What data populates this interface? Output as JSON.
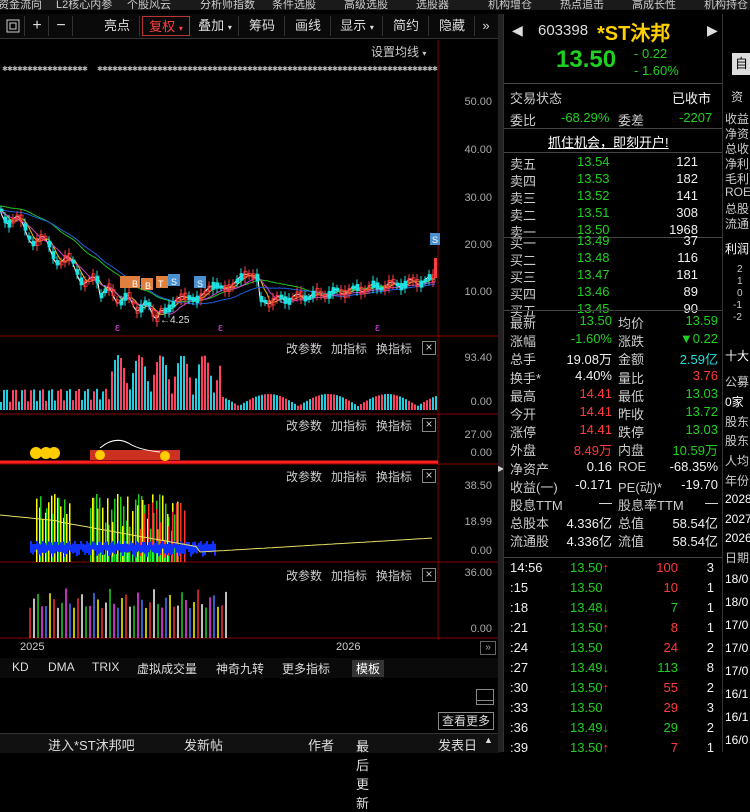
{
  "menu": [
    "资金流向",
    "L2核心内参",
    "个股风云",
    "分析师指数",
    "条件选股",
    "高级选股",
    "选股器",
    "机构增仓",
    "热点追击",
    "高成长性",
    "机构持仓"
  ],
  "toolbar": {
    "btn1": "亮点",
    "btn2": "复权",
    "btn3": "叠加",
    "btn4": "筹码",
    "btn5": "画线",
    "btn6": "显示",
    "btn7": "简约",
    "btn8": "隐藏"
  },
  "chart": {
    "setting_label": "设置均线",
    "price_axis": [
      "50.00",
      "40.00",
      "30.00",
      "20.00",
      "10.00"
    ],
    "low_label": "4.25",
    "markers": [
      "BS",
      "BS",
      "B",
      "T",
      "S",
      "S"
    ],
    "dates": [
      "2025",
      "2026"
    ]
  },
  "panel_controls": {
    "params": "改参数",
    "add": "加指标",
    "switch": "换指标",
    "close": "×"
  },
  "panels": [
    {
      "axis_top": "93.40",
      "axis_bottom": "0.00"
    },
    {
      "axis_top": "27.00",
      "axis_bottom": "0.00"
    },
    {
      "axis_top": "38.50",
      "axis_mid": "18.99",
      "axis_bottom": "0.00"
    },
    {
      "axis_top": "36.00",
      "axis_bottom": "0.00"
    }
  ],
  "bottom_tabs": [
    "KD",
    "DMA",
    "TRIX",
    "虚拟成交量",
    "神奇九转",
    "更多指标",
    "模板"
  ],
  "bottom_bar": {
    "enter": "进入*ST沐邦吧",
    "post": "发新帖",
    "author": "作者",
    "latest": "最后更新",
    "send": "发表日",
    "more": "查看更多"
  },
  "quote": {
    "code": "603398",
    "name": "*ST沐邦",
    "price": "13.50",
    "change": "- 0.22",
    "change_pct": "- 1.60%",
    "auto_btn": "自",
    "status_label": "交易状态",
    "status_value": "已收市",
    "weibi_label": "委比",
    "weibi_value": "-68.29%",
    "weicha_label": "委差",
    "weicha_value": "-2207",
    "promo": "抓住机会，即刻开户!",
    "asks": [
      {
        "label": "卖五",
        "price": "13.54",
        "vol": "121"
      },
      {
        "label": "卖四",
        "price": "13.53",
        "vol": "182"
      },
      {
        "label": "卖三",
        "price": "13.52",
        "vol": "141"
      },
      {
        "label": "卖二",
        "price": "13.51",
        "vol": "308"
      },
      {
        "label": "卖一",
        "price": "13.50",
        "vol": "1968"
      }
    ],
    "bids": [
      {
        "label": "买一",
        "price": "13.49",
        "vol": "37"
      },
      {
        "label": "买二",
        "price": "13.48",
        "vol": "116"
      },
      {
        "label": "买三",
        "price": "13.47",
        "vol": "181"
      },
      {
        "label": "买四",
        "price": "13.46",
        "vol": "89"
      },
      {
        "label": "买五",
        "price": "13.45",
        "vol": "90"
      }
    ],
    "stats": [
      {
        "l1": "最新",
        "v1": "13.50",
        "l2": "均价",
        "v2": "13.59"
      },
      {
        "l1": "涨幅",
        "v1": "-1.60%",
        "l2": "涨跌",
        "v2": "▼0.22"
      },
      {
        "l1": "总手",
        "v1": "19.08万",
        "l2": "金额",
        "v2": "2.59亿"
      },
      {
        "l1": "换手*",
        "v1": "4.40%",
        "l2": "量比",
        "v2": "3.76"
      },
      {
        "l1": "最高",
        "v1": "14.41",
        "l2": "最低",
        "v2": "13.03"
      },
      {
        "l1": "今开",
        "v1": "14.41",
        "l2": "昨收",
        "v2": "13.72"
      },
      {
        "l1": "涨停",
        "v1": "14.41",
        "l2": "跌停",
        "v2": "13.03"
      },
      {
        "l1": "外盘",
        "v1": "8.49万",
        "l2": "内盘",
        "v2": "10.59万"
      },
      {
        "l1": "净资产",
        "v1": "0.16",
        "l2": "ROE",
        "v2": "-68.35%"
      },
      {
        "l1": "收益(一)",
        "v1": "-0.171",
        "l2": "PE(动)*",
        "v2": "-19.70"
      },
      {
        "l1": "股息TTM",
        "v1": "—",
        "l2": "股息率TTM",
        "v2": "—"
      },
      {
        "l1": "总股本",
        "v1": "4.336亿",
        "l2": "总值",
        "v2": "58.54亿"
      },
      {
        "l1": "流通股",
        "v1": "4.336亿",
        "l2": "流值",
        "v2": "58.54亿"
      }
    ],
    "ticks": [
      {
        "t": "14:56",
        "p": "13.50",
        "a": "↑",
        "v": "100",
        "n": "3"
      },
      {
        "t": ":15",
        "p": "13.50",
        "a": "",
        "v": "10",
        "n": "1"
      },
      {
        "t": ":18",
        "p": "13.48",
        "a": "↓",
        "v": "7",
        "n": "1"
      },
      {
        "t": ":21",
        "p": "13.50",
        "a": "↑",
        "v": "8",
        "n": "1"
      },
      {
        "t": ":24",
        "p": "13.50",
        "a": "",
        "v": "24",
        "n": "2"
      },
      {
        "t": ":27",
        "p": "13.49",
        "a": "↓",
        "v": "113",
        "n": "8"
      },
      {
        "t": ":30",
        "p": "13.50",
        "a": "↑",
        "v": "55",
        "n": "2"
      },
      {
        "t": ":33",
        "p": "13.50",
        "a": "",
        "v": "29",
        "n": "3"
      },
      {
        "t": ":36",
        "p": "13.49",
        "a": "↓",
        "v": "29",
        "n": "2"
      },
      {
        "t": ":39",
        "p": "13.50",
        "a": "↑",
        "v": "7",
        "n": "1"
      }
    ]
  },
  "strip": {
    "labels": [
      "收益",
      "净资",
      "总收",
      "净利",
      "毛利",
      "ROE",
      "总股",
      "流通"
    ],
    "profit_label": "利润",
    "ten_label": "十大",
    "public_label": "公募",
    "zero_label": "0家",
    "holders": [
      "股东",
      "股东",
      "人均"
    ],
    "year_label": "年份",
    "years": [
      "2028",
      "2027",
      "2026"
    ],
    "date_label": "日期",
    "dates": [
      "18/0",
      "18/0",
      "17/0",
      "17/0",
      "17/0",
      "16/1",
      "16/1",
      "16/0"
    ],
    "mini_axis": [
      "2",
      "1",
      "0",
      "-1",
      "-2"
    ]
  },
  "colors": {
    "up": "#ff3b3b",
    "down": "#20d020",
    "accent": "#ffd000"
  }
}
